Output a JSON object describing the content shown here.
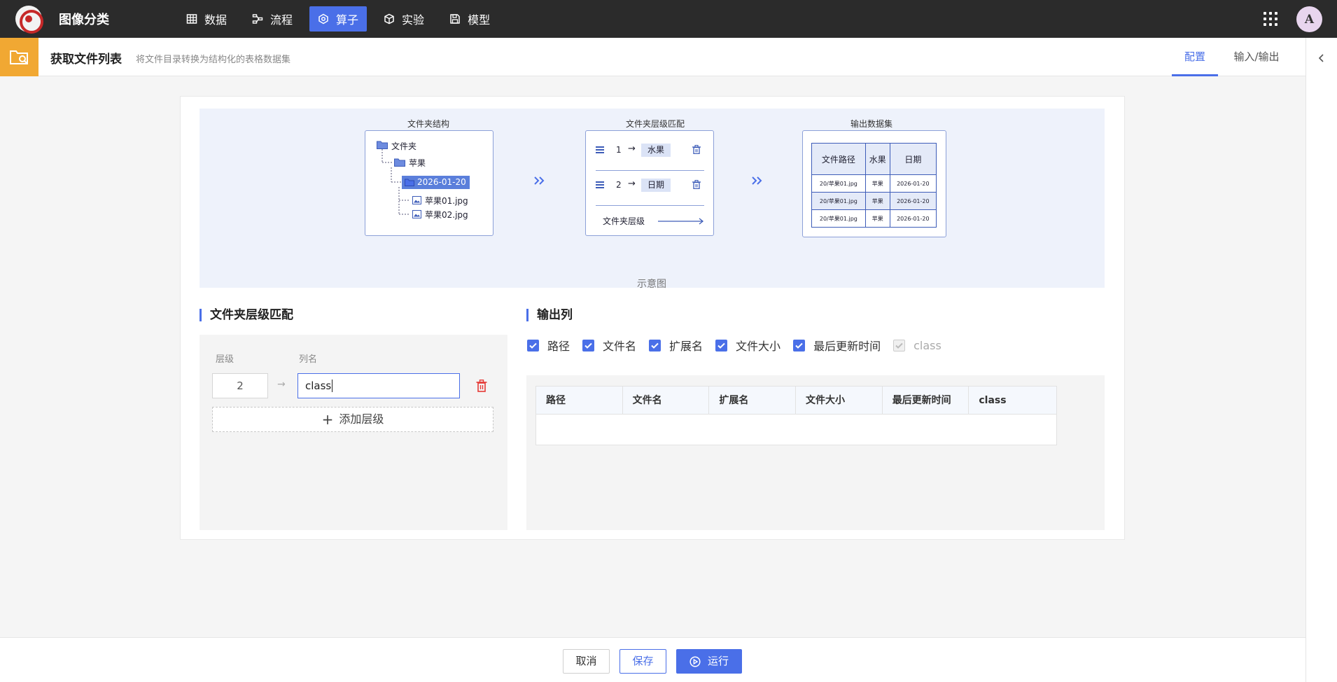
{
  "app": {
    "title": "图像分类",
    "avatar": "A"
  },
  "nav": [
    {
      "label": "数据",
      "icon": "table-icon",
      "active": false
    },
    {
      "label": "流程",
      "icon": "flow-icon",
      "active": false
    },
    {
      "label": "算子",
      "icon": "operator-icon",
      "active": true
    },
    {
      "label": "实验",
      "icon": "cube-icon",
      "active": false
    },
    {
      "label": "模型",
      "icon": "save-icon",
      "active": false
    }
  ],
  "header": {
    "title": "获取文件列表",
    "subtitle": "将文件目录转换为结构化的表格数据集",
    "tabs": [
      {
        "label": "配置",
        "active": true
      },
      {
        "label": "输入/输出",
        "active": false
      }
    ]
  },
  "illustration": {
    "folder_structure": {
      "title": "文件夹结构",
      "root": "文件夹",
      "sub": "苹果",
      "date": "2026-01-20",
      "files": [
        "苹果01.jpg",
        "苹果02.jpg"
      ]
    },
    "level_match": {
      "title": "文件夹层级匹配",
      "rows": [
        {
          "level": "1",
          "name": "水果"
        },
        {
          "level": "2",
          "name": "日期"
        }
      ],
      "axis": "文件夹层级"
    },
    "output": {
      "title": "输出数据集",
      "headers": [
        "文件路径",
        "水果",
        "日期"
      ],
      "rows": [
        [
          "20/苹果01.jpg",
          "苹果",
          "2026-01-20"
        ],
        [
          "20/苹果01.jpg",
          "苹果",
          "2026-01-20"
        ],
        [
          "20/苹果01.jpg",
          "苹果",
          "2026-01-20"
        ]
      ]
    },
    "caption": "示意图"
  },
  "level_section": {
    "title": "文件夹层级匹配",
    "level_label": "层级",
    "name_label": "列名",
    "level_value": "2",
    "name_value": "class",
    "add_label": "添加层级"
  },
  "output_section": {
    "title": "输出列",
    "columns": [
      {
        "label": "路径",
        "checked": true,
        "disabled": false
      },
      {
        "label": "文件名",
        "checked": true,
        "disabled": false
      },
      {
        "label": "扩展名",
        "checked": true,
        "disabled": false
      },
      {
        "label": "文件大小",
        "checked": true,
        "disabled": false
      },
      {
        "label": "最后更新时间",
        "checked": true,
        "disabled": false
      },
      {
        "label": "class",
        "checked": true,
        "disabled": true
      }
    ],
    "table_headers": [
      "路径",
      "文件名",
      "扩展名",
      "文件大小",
      "最后更新时间",
      "class"
    ]
  },
  "footer": {
    "cancel": "取消",
    "save": "保存",
    "run": "运行"
  },
  "colors": {
    "accent": "#4a6fe8",
    "topbar": "#2b2b2b",
    "header_icon": "#f1a833",
    "danger": "#e53935"
  }
}
